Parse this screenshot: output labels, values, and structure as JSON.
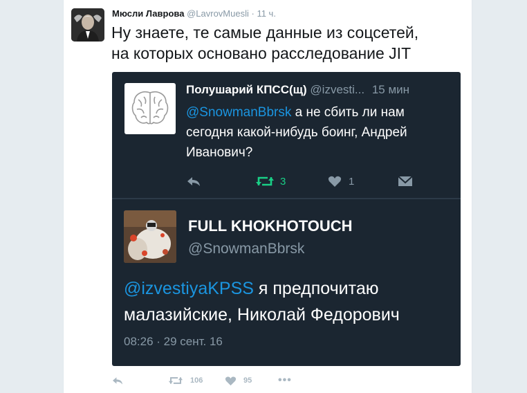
{
  "tweet": {
    "author_name": "Мюсли Лаврова",
    "author_handle": "@LavrovMuesli",
    "separator": "·",
    "time": "11 ч.",
    "text_line1": "Ну знаете, те самые данные из соцсетей,",
    "text_line2": "на которых основано расследование JIT",
    "actions": {
      "retweets": "106",
      "likes": "95"
    }
  },
  "quoted": {
    "author_name": "Полушарий КПСС(щ)",
    "author_handle": "@izvesti...",
    "time": "15 мин",
    "mention": "@SnowmanBbrsk",
    "text_part1": " а не сбить ли нам",
    "text_line2": "сегодня какой-нибудь боинг, Андрей",
    "text_line3": "Иванович?",
    "retweets": "3",
    "likes": "1"
  },
  "reply": {
    "author_name": "FULL KHOKHOTOUCH",
    "author_handle": "@SnowmanBbrsk",
    "mention": "@izvestiyaKPSS",
    "text_part1": " я предпочитаю",
    "text_line2": "малазийские, Николай Федорович",
    "timestamp": "08:26 · 29 сент. 16"
  },
  "colors": {
    "link": "#1b95e0",
    "retweet_green": "#19cf86",
    "dark_card": "#1b2631",
    "muted": "#8899a6"
  },
  "icons": [
    "reply-icon",
    "retweet-icon",
    "like-icon",
    "dm-icon",
    "more-icon"
  ]
}
